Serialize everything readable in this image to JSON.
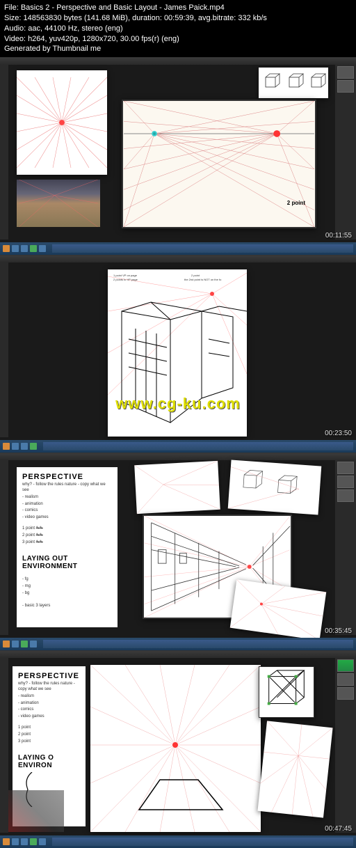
{
  "info": {
    "file_label": "File:",
    "file_value": "Basics 2 - Perspective and Basic Layout - James Paick.mp4",
    "size_label": "Size:",
    "size_value": "148563830 bytes (141.68 MiB), duration: 00:59:39, avg.bitrate: 332 kb/s",
    "audio_label": "Audio:",
    "audio_value": "aac, 44100 Hz, stereo (eng)",
    "video_label": "Video:",
    "video_value": "h264, yuv420p, 1280x720, 30.00 fps(r) (eng)",
    "generated": "Generated by Thumbnail me"
  },
  "timestamps": {
    "t1": "00:11:55",
    "t2": "00:23:50",
    "t3": "00:35:45",
    "t4": "00:47:45"
  },
  "labels": {
    "two_point": "2 point",
    "perspective": "PERSPECTIVE",
    "laying_out": "LAYING OUT",
    "environment": "ENVIRONMENT",
    "laying_o": "LAYING O",
    "environ": "ENVIRON",
    "why_line": "why? - follow the rules nature - copy what we see",
    "realism": "- realism",
    "animation": "- animation",
    "comics": "- comics",
    "video_games": "- video games",
    "p1": "1 point",
    "p2": "2 point",
    "p3": "3 point",
    "fg": "- fg",
    "mg": "- mg",
    "bg": "- bg",
    "basic": "- basic 3 layers"
  },
  "watermark": "www.cg-ku.com"
}
